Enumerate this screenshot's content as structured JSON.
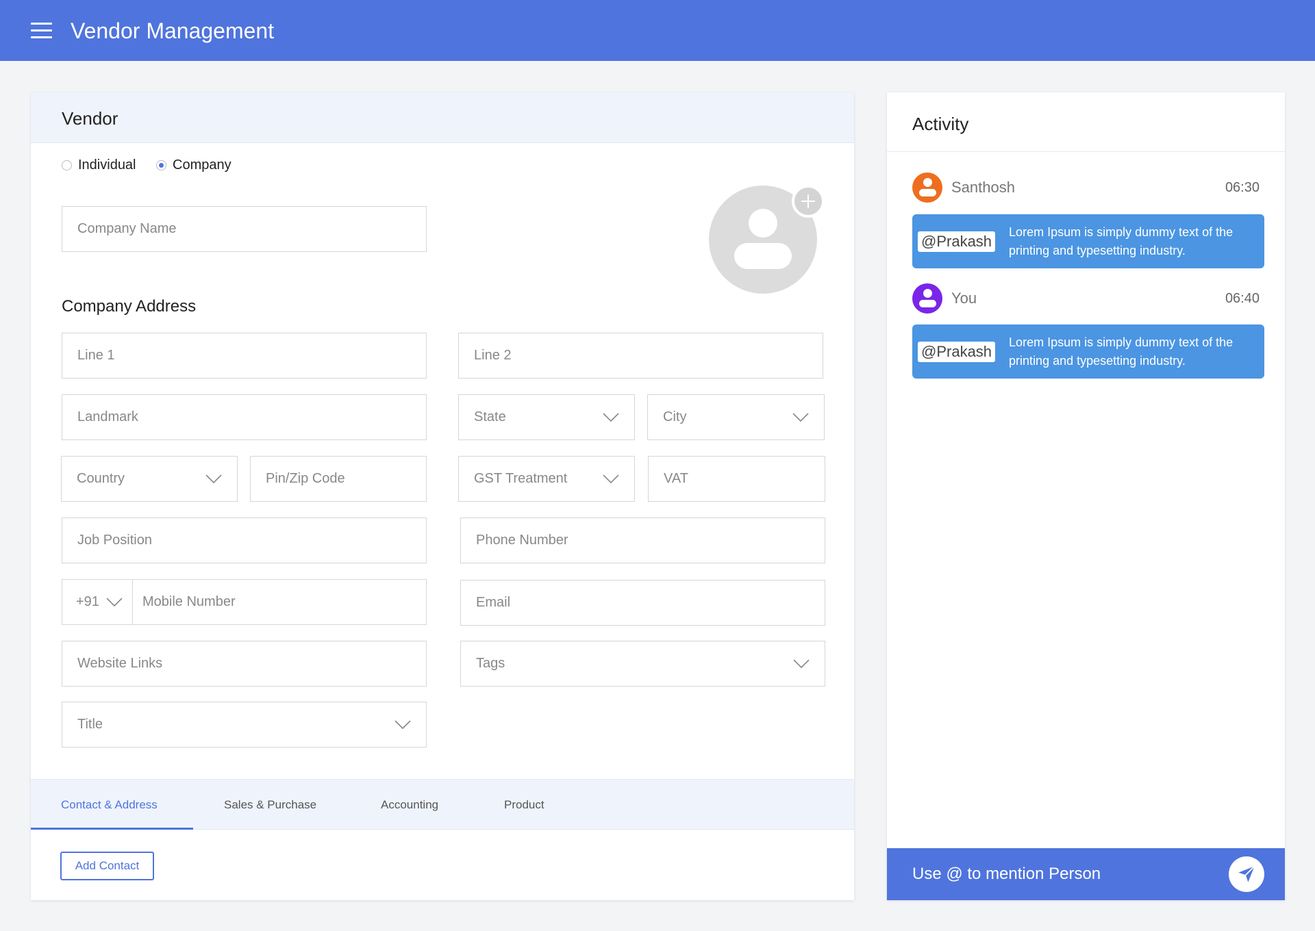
{
  "header": {
    "title": "Vendor Management"
  },
  "vendor": {
    "title": "Vendor",
    "type_options": [
      {
        "label": "Individual",
        "selected": false
      },
      {
        "label": "Company",
        "selected": true
      }
    ],
    "company_name_placeholder": "Company Name",
    "address_section_label": "Company Address",
    "fields": {
      "line1": "Line 1",
      "line2": "Line 2",
      "landmark": "Landmark",
      "state": "State",
      "city": "City",
      "country": "Country",
      "pin": "Pin/Zip Code",
      "gst": "GST Treatment",
      "vat": "VAT",
      "job_position": "Job Position",
      "phone": "Phone Number",
      "country_code": "+91",
      "mobile": "Mobile Number",
      "email": "Email",
      "website": "Website Links",
      "tags": "Tags",
      "title": "Title"
    },
    "tabs": [
      {
        "label": "Contact & Address",
        "active": true
      },
      {
        "label": "Sales & Purchase",
        "active": false
      },
      {
        "label": "Accounting",
        "active": false
      },
      {
        "label": "Product",
        "active": false
      }
    ],
    "add_contact_label": "Add Contact"
  },
  "activity": {
    "title": "Activity",
    "entries": [
      {
        "user": "Santhosh",
        "time": "06:30",
        "avatar_color": "#ee6e1f",
        "mention": "@Prakash",
        "message": "Lorem Ipsum is simply dummy text of the printing and typesetting industry."
      },
      {
        "user": "You",
        "time": "06:40",
        "avatar_color": "#7a25e8",
        "mention": "@Prakash",
        "message": "Lorem Ipsum is simply dummy text of the printing and typesetting industry."
      }
    ],
    "composer_placeholder": "Use @ to mention Person"
  },
  "colors": {
    "primary": "#4f74dd",
    "message_bubble": "#4b95e2",
    "panel_header": "#eff3fc"
  },
  "icons": {
    "menu": "menu-icon",
    "add_photo": "plus-icon",
    "send": "send-icon",
    "dropdown": "chevron-down-icon"
  }
}
